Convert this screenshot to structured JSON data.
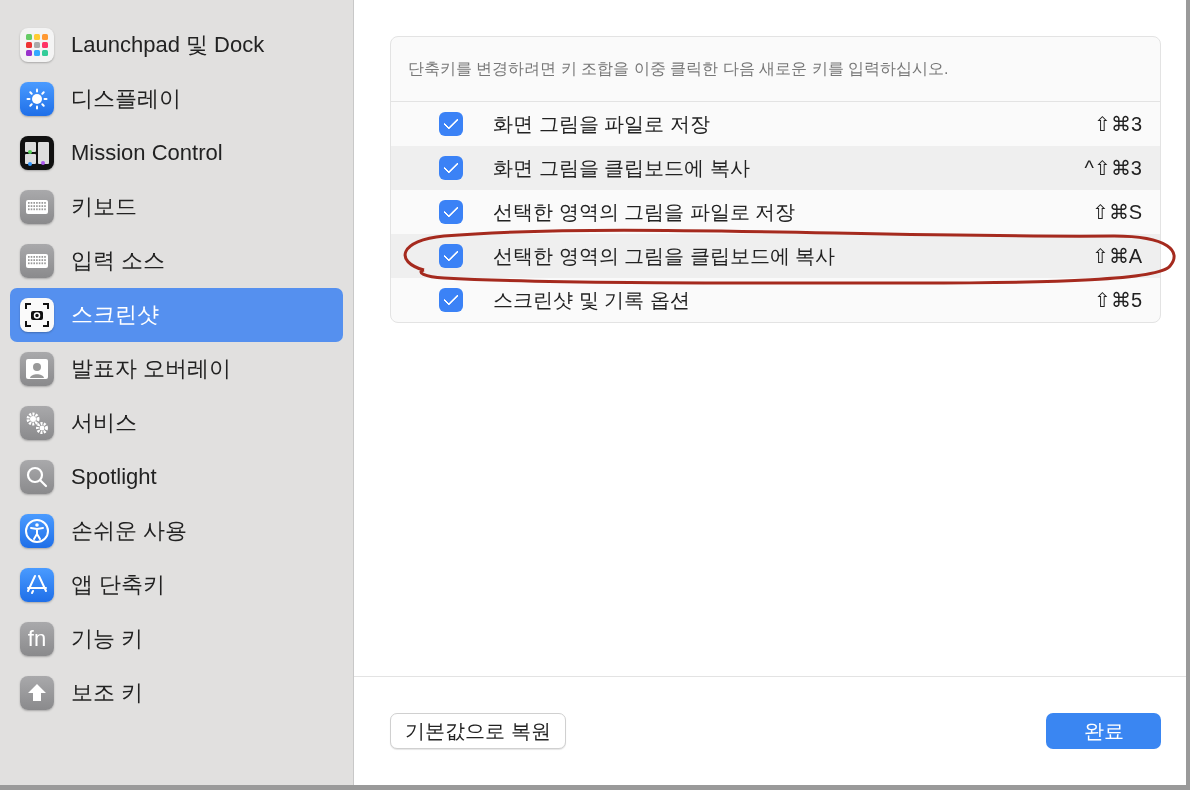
{
  "sidebar": {
    "items": [
      {
        "label": "Launchpad 및 Dock",
        "selected": false
      },
      {
        "label": "디스플레이",
        "selected": false
      },
      {
        "label": "Mission Control",
        "selected": false
      },
      {
        "label": "키보드",
        "selected": false
      },
      {
        "label": "입력 소스",
        "selected": false
      },
      {
        "label": "스크린샷",
        "selected": true
      },
      {
        "label": "발표자 오버레이",
        "selected": false
      },
      {
        "label": "서비스",
        "selected": false
      },
      {
        "label": "Spotlight",
        "selected": false
      },
      {
        "label": "손쉬운 사용",
        "selected": false
      },
      {
        "label": "앱 단축키",
        "selected": false
      },
      {
        "label": "기능 키",
        "selected": false,
        "icon_text": "fn"
      },
      {
        "label": "보조 키",
        "selected": false
      }
    ]
  },
  "shortcuts": {
    "hint": "단축키를 변경하려면 키 조합을 이중 클릭한 다음 새로운 키를 입력하십시오.",
    "rows": [
      {
        "checked": true,
        "label": "화면 그림을 파일로 저장",
        "shortcut": "⇧⌘3"
      },
      {
        "checked": true,
        "label": "화면 그림을 클립보드에 복사",
        "shortcut": "^⇧⌘3"
      },
      {
        "checked": true,
        "label": "선택한 영역의 그림을 파일로 저장",
        "shortcut": "⇧⌘S"
      },
      {
        "checked": true,
        "label": "선택한 영역의 그림을 클립보드에 복사",
        "shortcut": "⇧⌘A"
      },
      {
        "checked": true,
        "label": "스크린샷 및 기록 옵션",
        "shortcut": "⇧⌘5"
      }
    ]
  },
  "buttons": {
    "restore": "기본값으로 복원",
    "done": "완료"
  }
}
